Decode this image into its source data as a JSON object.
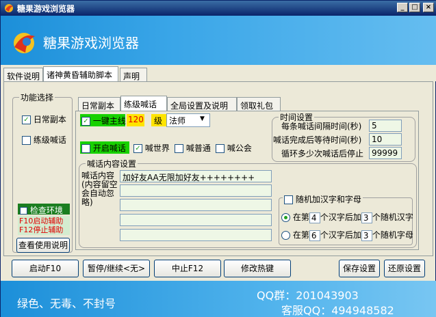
{
  "window": {
    "title": "糖果游戏浏览器",
    "min": "_",
    "max": "□",
    "close": "×"
  },
  "header": {
    "title": "糖果游戏浏览器"
  },
  "top_tabs": [
    "软件说明",
    "诸神黄昏辅助脚本",
    "声明"
  ],
  "function_select": {
    "title": "功能选择",
    "daily": "日常副本",
    "level_shout": "练级喊话",
    "check_env": "检查环境",
    "hint1": "F10启动辅助",
    "hint2": "F12停止辅助",
    "manual_btn": "查看使用说明"
  },
  "inner_tabs": [
    "日常副本",
    "练级喊话",
    "全局设置及说明",
    "领取礼包"
  ],
  "main": {
    "one_key": "一键主线",
    "level_value": "120",
    "level_label": "级",
    "class_value": "法师",
    "open_shout": "开启喊话",
    "shout_world": "喊世界",
    "shout_normal": "喊普通",
    "shout_guild": "喊公会"
  },
  "time_settings": {
    "title": "时间设置",
    "interval_label": "每条喊话间隔时间(秒)",
    "interval_value": "5",
    "wait_label": "喊话完成后等待时间(秒)",
    "wait_value": "10",
    "loop_label": "循环多少次喊话后停止",
    "loop_value": "99999"
  },
  "shout_content": {
    "title": "喊话内容设置",
    "label": "喊话内容(内容留空会自动忽略)",
    "line1": "加好友AA无限加好友++++++++",
    "random_title": "随机加汉字和字母",
    "opt1_a": "在第",
    "opt1_n": "4",
    "opt1_b": "个汉字后加",
    "opt1_m": "3",
    "opt1_c": "个随机汉字",
    "opt2_a": "在第",
    "opt2_n": "6",
    "opt2_b": "个汉字后加",
    "opt2_m": "3",
    "opt2_c": "个随机字母"
  },
  "buttons": {
    "start": "启动F10",
    "pause": "暂停/继续<无>",
    "stop": "中止F12",
    "hotkey": "修改热键",
    "save": "保存设置",
    "restore": "还原设置"
  },
  "footer": {
    "slogan": "绿色、无毒、不封号",
    "qq_group": "QQ群：201043903",
    "qq_service": "客服QQ：494948582"
  }
}
